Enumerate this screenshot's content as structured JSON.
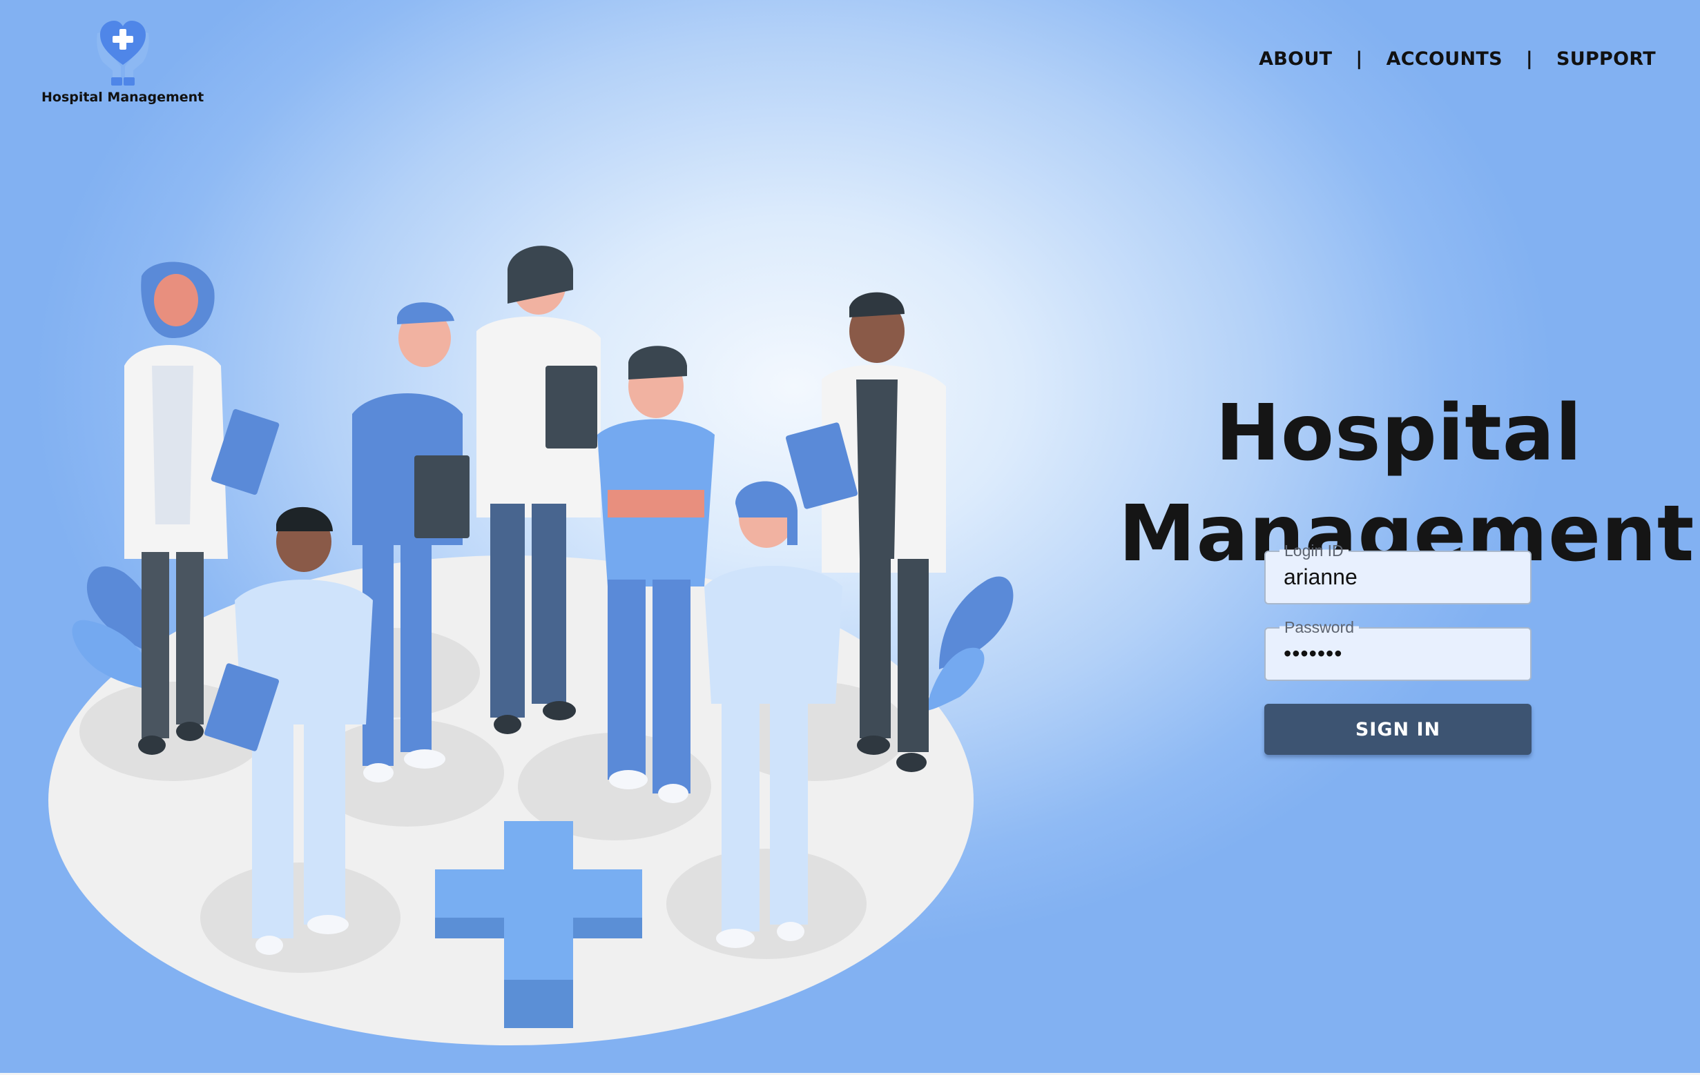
{
  "brand": {
    "name": "Hospital Management",
    "logo_icon": "heart-hands-icon",
    "colors": {
      "logo_heart": "#4f86e8",
      "logo_hands": "#8cb8f3"
    }
  },
  "nav": {
    "items": [
      {
        "label": "ABOUT"
      },
      {
        "label": "ACCOUNTS"
      },
      {
        "label": "SUPPORT"
      }
    ],
    "separator": "|"
  },
  "hero": {
    "title_line1": "Hospital",
    "title_line2": "Management",
    "illustration": "medical-team-illustration"
  },
  "login": {
    "login_id_label": "Login ID",
    "login_id_value": "arianne",
    "password_label": "Password",
    "password_value": "•••••••",
    "submit_label": "SIGN IN"
  },
  "colors": {
    "background_light": "#f3f8fe",
    "background_dark": "#82b1f2",
    "input_bg": "#e8f0fe",
    "button_bg": "#3d5472",
    "text": "#151515"
  }
}
